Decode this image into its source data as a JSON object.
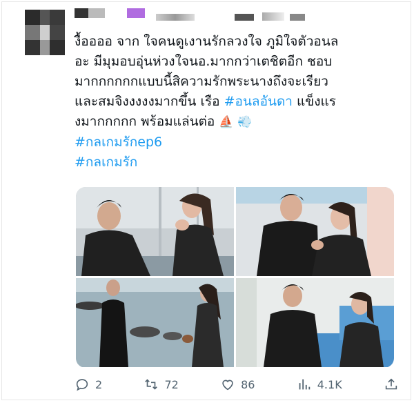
{
  "post": {
    "lines": [
      "งื้ออออ จาก ใจคนดูเงานรักลวงใจ ภูมิใจตัวอนล",
      "อะ มีมุมอบอุ่นห่วงใจนอ.มากกว่าเตชิตอีก ชอบ",
      "มากกกกกกแบบนี้สิความรักพระนางถึงจะเรียว",
      "และสมจิงงงงงมากขึ้น เรือ "
    ],
    "hashtag_inline": "#อนลอันดา",
    "line4_tail": " แข็งแร",
    "line5": "งมากกกกก พร้อมแล่นต่อ",
    "emojis": "⛵ 💨",
    "hashtags": [
      "#กลเกมรักep6",
      "#กลเกมรัก"
    ]
  },
  "media": [
    {
      "name": "photo-1",
      "alt": "couple seated by window"
    },
    {
      "name": "photo-2",
      "alt": "man comforting crying woman"
    },
    {
      "name": "photo-3",
      "alt": "couple facing each other by the sea"
    },
    {
      "name": "photo-4",
      "alt": "couple seated on blue couch"
    }
  ],
  "actions": {
    "replies": "2",
    "reposts": "72",
    "likes": "86",
    "views": "4.1K"
  },
  "colors": {
    "link": "#1d9bf0",
    "text": "#0f1419",
    "muted": "#536471"
  }
}
